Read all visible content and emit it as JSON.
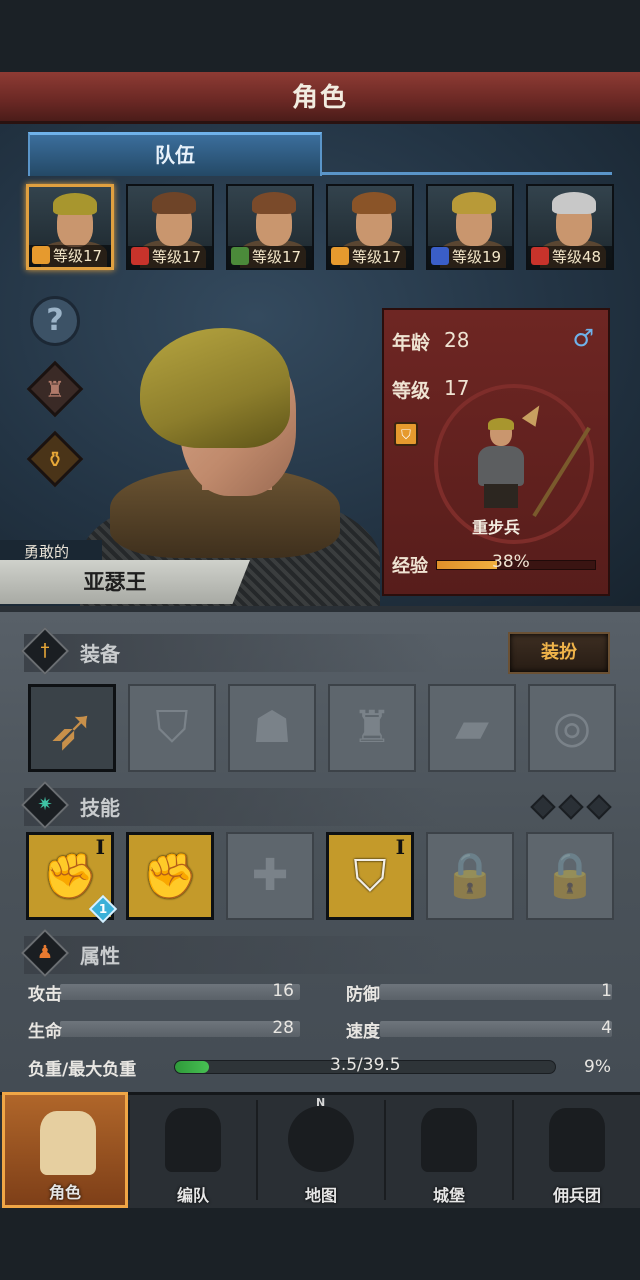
{
  "header": {
    "title": "角色"
  },
  "team_tab": {
    "label": "队伍"
  },
  "party": [
    {
      "level_label": "等级17",
      "class_color": "#e69a2e",
      "hair": "#a8962e",
      "selected": true
    },
    {
      "level_label": "等级17",
      "class_color": "#c8332b",
      "hair": "#6e4428",
      "selected": false
    },
    {
      "level_label": "等级17",
      "class_color": "#4b8a3a",
      "hair": "#7a4a2a",
      "selected": false
    },
    {
      "level_label": "等级17",
      "class_color": "#e69a2e",
      "hair": "#8a5428",
      "selected": false
    },
    {
      "level_label": "等级19",
      "class_color": "#3a5ec8",
      "hair": "#b89a38",
      "selected": false
    },
    {
      "level_label": "等级48",
      "class_color": "#c8332b",
      "hair": "#c8c8c8",
      "selected": false
    }
  ],
  "side_buttons": [
    {
      "icon": "question-icon",
      "glyph": "?"
    },
    {
      "icon": "armor-icon",
      "glyph": "♜"
    },
    {
      "icon": "potion-icon",
      "glyph": "⚱"
    }
  ],
  "hero": {
    "epithet": "勇敢的",
    "name": "亚瑟王"
  },
  "info_card": {
    "age_label": "年龄",
    "age_value": "28",
    "gender_symbol": "♂",
    "level_label": "等级",
    "level_value": "17",
    "unit_name": "重步兵",
    "exp_label": "经验",
    "exp_value": "38%",
    "exp_fraction": 0.38
  },
  "equipment": {
    "title": "装备",
    "dress_button": "装扮",
    "slots": [
      {
        "icon": "spear-icon",
        "glyph": "➶",
        "filled": true
      },
      {
        "icon": "shield-slot-icon",
        "glyph": "⛉",
        "filled": false
      },
      {
        "icon": "helmet-slot-icon",
        "glyph": "☗",
        "filled": false
      },
      {
        "icon": "armor-slot-icon",
        "glyph": "♜",
        "filled": false
      },
      {
        "icon": "boots-slot-icon",
        "glyph": "▰",
        "filled": false
      },
      {
        "icon": "ring-slot-icon",
        "glyph": "◎",
        "filled": false
      }
    ]
  },
  "skills": {
    "title": "技能",
    "slots": [
      {
        "icon": "spear-thrust-skill-icon",
        "glyph": "✊",
        "state": "active",
        "rank": "I",
        "badge": "1"
      },
      {
        "icon": "gauntlet-skill-icon",
        "glyph": "✊",
        "state": "active",
        "rank": "",
        "badge": ""
      },
      {
        "icon": "cross-skill-icon",
        "glyph": "✚",
        "state": "empty",
        "rank": "",
        "badge": ""
      },
      {
        "icon": "shield-skill-icon",
        "glyph": "⛉",
        "state": "active",
        "rank": "I",
        "badge": ""
      },
      {
        "icon": "lock-icon",
        "glyph": "🔒",
        "state": "locked",
        "rank": "",
        "badge": ""
      },
      {
        "icon": "lock-icon",
        "glyph": "🔒",
        "state": "locked",
        "rank": "",
        "badge": ""
      }
    ]
  },
  "attributes": {
    "title": "属性",
    "attack_label": "攻击",
    "attack_value": "16",
    "defense_label": "防御",
    "defense_value": "1",
    "hp_label": "生命",
    "hp_value": "28",
    "speed_label": "速度",
    "speed_value": "4",
    "load_label": "负重/最大负重",
    "load_value": "3.5/39.5",
    "load_percent": "9%",
    "load_fraction": 0.09
  },
  "nav": [
    {
      "label": "角色",
      "icon": "knight-icon",
      "selected": true
    },
    {
      "label": "编队",
      "icon": "helmet-icon",
      "selected": false
    },
    {
      "label": "地图",
      "icon": "compass-map-icon",
      "selected": false,
      "mark": "N"
    },
    {
      "label": "城堡",
      "icon": "castle-icon",
      "selected": false
    },
    {
      "label": "佣兵团",
      "icon": "mercenary-flag-icon",
      "selected": false
    }
  ],
  "colors": {
    "accent": "#f0a646",
    "header_red": "#8e3b34",
    "tab_blue": "#3b6e9c"
  }
}
